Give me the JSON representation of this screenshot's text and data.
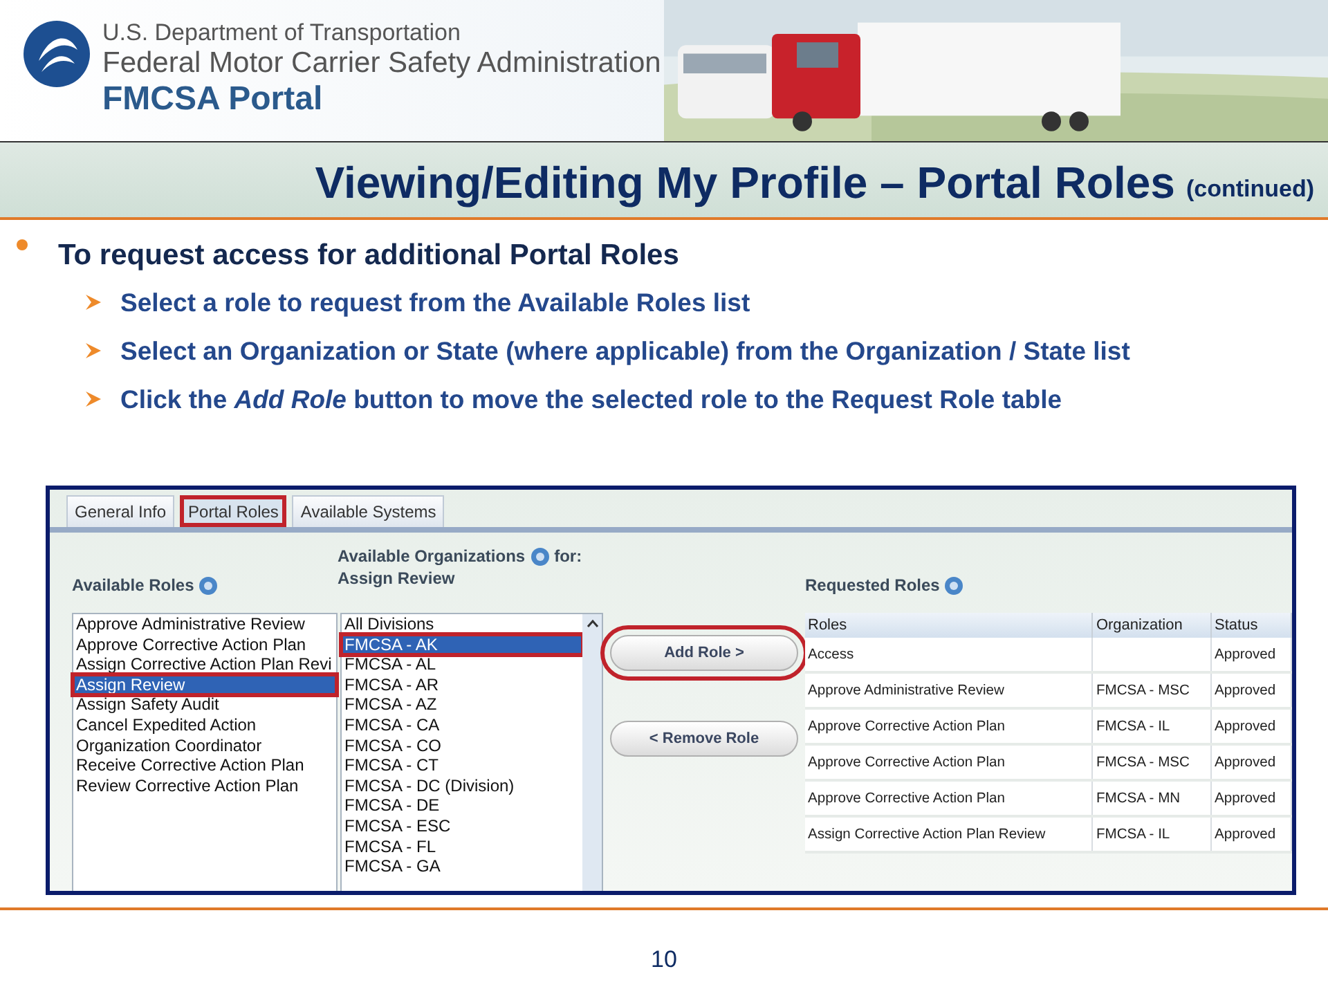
{
  "header": {
    "agency": "U.S. Department of Transportation",
    "administration": "Federal Motor Carrier Safety Administration",
    "portal": "FMCSA Portal"
  },
  "slide_title": {
    "main": "Viewing/Editing My Profile – Portal Roles",
    "suffix": "(continued)"
  },
  "bullets": [
    {
      "text": "To request access for additional Portal Roles",
      "children": [
        {
          "text": "Select a role to request from the Available Roles list"
        },
        {
          "text": "Select an Organization or State (where applicable) from the Organization / State list"
        },
        {
          "text": "Click the *Add Role* button to move the selected role to the Request Role table"
        }
      ]
    }
  ],
  "screenshot": {
    "tabs": [
      {
        "label": "General Info",
        "selected": false,
        "highlighted": false
      },
      {
        "label": "Portal Roles",
        "selected": true,
        "highlighted": true
      },
      {
        "label": "Available Systems",
        "selected": false,
        "highlighted": false
      }
    ],
    "available_roles": {
      "heading": "Available Roles",
      "items": [
        {
          "label": "Approve Administrative Review",
          "selected": false,
          "highlighted": false
        },
        {
          "label": "Approve Corrective Action Plan",
          "selected": false,
          "highlighted": false
        },
        {
          "label": "Assign Corrective Action Plan Revi",
          "selected": false,
          "highlighted": false
        },
        {
          "label": "Assign Review",
          "selected": true,
          "highlighted": true
        },
        {
          "label": "Assign Safety Audit",
          "selected": false,
          "highlighted": false
        },
        {
          "label": "Cancel Expedited Action",
          "selected": false,
          "highlighted": false
        },
        {
          "label": "Organization Coordinator",
          "selected": false,
          "highlighted": false
        },
        {
          "label": "Receive Corrective Action Plan",
          "selected": false,
          "highlighted": false
        },
        {
          "label": "Review Corrective Action Plan",
          "selected": false,
          "highlighted": false
        }
      ]
    },
    "available_organizations": {
      "heading": "Available Organizations",
      "for_label": "for:",
      "role": "Assign Review",
      "items": [
        {
          "label": "All Divisions",
          "selected": false,
          "highlighted": false
        },
        {
          "label": "FMCSA - AK",
          "selected": true,
          "highlighted": true
        },
        {
          "label": "FMCSA - AL",
          "selected": false,
          "highlighted": false
        },
        {
          "label": "FMCSA - AR",
          "selected": false,
          "highlighted": false
        },
        {
          "label": "FMCSA - AZ",
          "selected": false,
          "highlighted": false
        },
        {
          "label": "FMCSA - CA",
          "selected": false,
          "highlighted": false
        },
        {
          "label": "FMCSA - CO",
          "selected": false,
          "highlighted": false
        },
        {
          "label": "FMCSA - CT",
          "selected": false,
          "highlighted": false
        },
        {
          "label": "FMCSA - DC (Division)",
          "selected": false,
          "highlighted": false
        },
        {
          "label": "FMCSA - DE",
          "selected": false,
          "highlighted": false
        },
        {
          "label": "FMCSA - ESC",
          "selected": false,
          "highlighted": false
        },
        {
          "label": "FMCSA - FL",
          "selected": false,
          "highlighted": false
        },
        {
          "label": "FMCSA - GA",
          "selected": false,
          "highlighted": false
        }
      ]
    },
    "buttons": [
      {
        "label": "Add Role >",
        "highlighted": true
      },
      {
        "label": "< Remove Role",
        "highlighted": false
      }
    ],
    "requested_roles": {
      "heading": "Requested Roles",
      "columns": [
        "Roles",
        "Organization",
        "Status"
      ],
      "rows": [
        [
          "Access",
          "",
          "Approved"
        ],
        [
          "Approve Administrative Review",
          "FMCSA - MSC",
          "Approved"
        ],
        [
          "Approve Corrective Action Plan",
          "FMCSA - IL",
          "Approved"
        ],
        [
          "Approve Corrective Action Plan",
          "FMCSA - MSC",
          "Approved"
        ],
        [
          "Approve Corrective Action Plan",
          "FMCSA - MN",
          "Approved"
        ],
        [
          "Assign Corrective Action Plan Review",
          "FMCSA - IL",
          "Approved"
        ]
      ]
    }
  },
  "page_number": "10"
}
